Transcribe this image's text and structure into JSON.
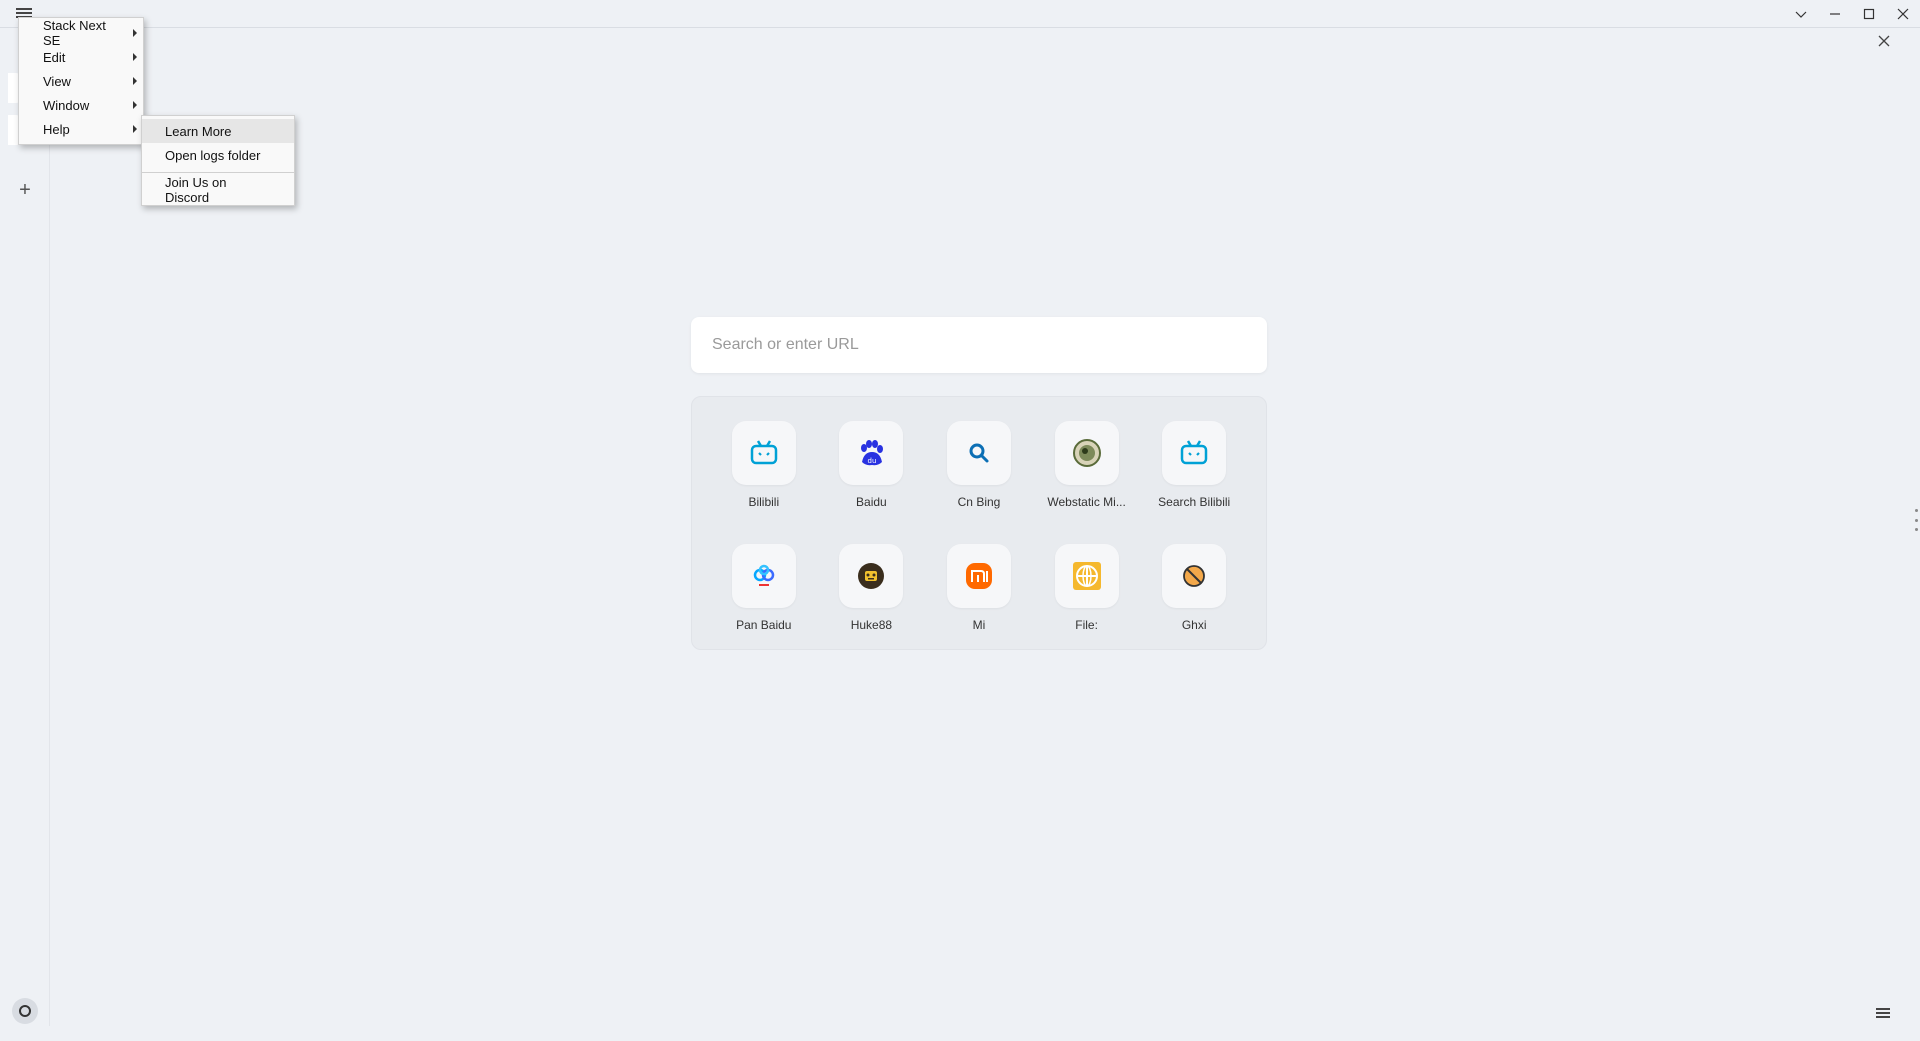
{
  "window": {
    "controls": [
      "chevron-down",
      "minimize",
      "maximize",
      "close"
    ]
  },
  "app_menu": {
    "items": [
      {
        "label": "Stack Next SE",
        "has_submenu": true
      },
      {
        "label": "Edit",
        "has_submenu": true
      },
      {
        "label": "View",
        "has_submenu": true
      },
      {
        "label": "Window",
        "has_submenu": true
      },
      {
        "label": "Help",
        "has_submenu": true,
        "active": true
      }
    ]
  },
  "help_menu": {
    "items": [
      "Learn More",
      "Open logs folder",
      "Join Us on Discord"
    ]
  },
  "search": {
    "placeholder": "Search or enter URL"
  },
  "shortcuts": [
    {
      "label": "Bilibili",
      "icon": "bilibili-icon",
      "color": "#00a1d6"
    },
    {
      "label": "Baidu",
      "icon": "baidu-icon",
      "color": "#2932e1"
    },
    {
      "label": "Cn Bing",
      "icon": "search-icon",
      "color": "#0c6fb5"
    },
    {
      "label": "Webstatic Mi...",
      "icon": "webstatic-icon",
      "color": "#5a6b3a"
    },
    {
      "label": "Search Bilibili",
      "icon": "bilibili-icon",
      "color": "#00a1d6"
    },
    {
      "label": "Pan Baidu",
      "icon": "pan-baidu-icon",
      "color": "#06a7ff"
    },
    {
      "label": "Huke88",
      "icon": "huke88-icon",
      "color": "#3a2d1d"
    },
    {
      "label": "Mi",
      "icon": "mi-icon",
      "color": "#ff6900"
    },
    {
      "label": "File:",
      "icon": "file-icon",
      "color": "#f5b82e"
    },
    {
      "label": "Ghxi",
      "icon": "ghxi-icon",
      "color": "#e07a20"
    }
  ]
}
